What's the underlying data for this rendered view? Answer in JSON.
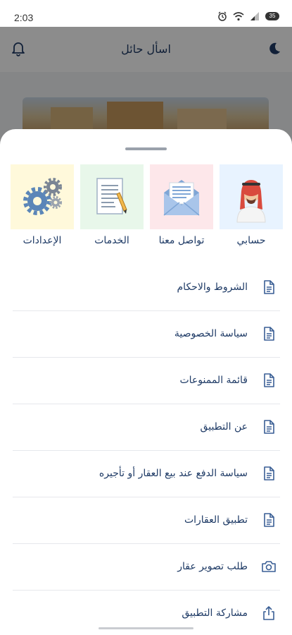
{
  "status_bar": {
    "time": "2:03",
    "battery": "35",
    "icons": [
      "alarm-icon",
      "wifi-icon",
      "signal-icon",
      "battery-icon"
    ]
  },
  "background_page": {
    "title": "اسأل حائل",
    "icons": [
      "bell-icon",
      "moon-star-icon"
    ]
  },
  "sheet": {
    "tiles": [
      {
        "label": "حسابي",
        "icon": "account-avatar-icon",
        "bg": "#e8f3ff"
      },
      {
        "label": "تواصل معنا",
        "icon": "envelope-icon",
        "bg": "#fde7ea"
      },
      {
        "label": "الخدمات",
        "icon": "document-pencil-icon",
        "bg": "#e8f7ea"
      },
      {
        "label": "الإعدادات",
        "icon": "gears-icon",
        "bg": "#fff9db"
      }
    ],
    "menu_items": [
      {
        "label": "الشروط والاحكام",
        "icon": "document-icon"
      },
      {
        "label": "سياسة الخصوصية",
        "icon": "document-icon"
      },
      {
        "label": "قائمة الممنوعات",
        "icon": "document-icon"
      },
      {
        "label": "عن التطبيق",
        "icon": "document-icon"
      },
      {
        "label": "سياسة الدفع عند بيع العقار أو تأجيره",
        "icon": "document-icon"
      },
      {
        "label": "تطبيق العقارات",
        "icon": "document-icon"
      },
      {
        "label": "طلب تصوير عقار",
        "icon": "camera-icon"
      },
      {
        "label": "مشاركة التطبيق",
        "icon": "share-icon"
      }
    ]
  },
  "colors": {
    "text": "#1f3b66",
    "accent": "#3a5f95",
    "divider": "#e6e8ec",
    "scrim": "rgba(0,0,0,0.45)"
  }
}
